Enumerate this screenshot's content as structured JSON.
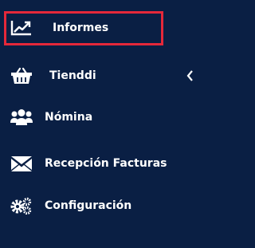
{
  "sidebar": {
    "items": [
      {
        "label": "Informes",
        "icon": "line-chart-icon",
        "active": true
      },
      {
        "label": "Tienddi",
        "icon": "shopping-basket-icon",
        "has_submenu": true
      },
      {
        "label": "Nómina",
        "icon": "users-icon"
      },
      {
        "label": "Recepción Facturas",
        "icon": "envelope-icon"
      },
      {
        "label": "Configuración",
        "icon": "cogs-icon"
      }
    ]
  },
  "colors": {
    "background": "#0a1f44",
    "text": "#ffffff",
    "highlight_border": "#e5283a"
  }
}
